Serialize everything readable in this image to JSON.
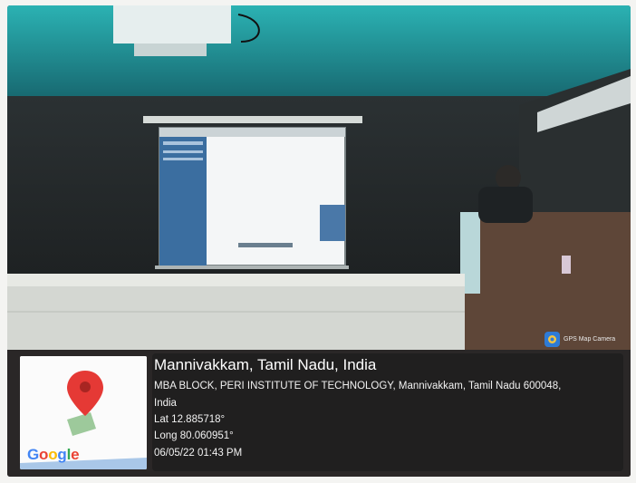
{
  "location": {
    "place": "Mannivakkam, Tamil Nadu, India",
    "address_line1": "MBA BLOCK, PERI INSTITUTE OF TECHNOLOGY, Mannivakkam, Tamil Nadu 600048,",
    "address_line2": "India",
    "latitude": "Lat 12.885718°",
    "longitude": "Long 80.060951°",
    "datetime": "06/05/22 01:43 PM"
  },
  "map": {
    "logo_text": [
      "G",
      "o",
      "o",
      "g",
      "l",
      "e"
    ],
    "pin_icon": "map-pin-icon"
  },
  "badge": {
    "label": "GPS Map Camera",
    "icon": "gps-map-camera-icon"
  },
  "colors": {
    "overlay": "#1e1e1e",
    "pin": "#e53935",
    "screen": "#f3f5f7",
    "ceiling": "#2aa6a8"
  }
}
